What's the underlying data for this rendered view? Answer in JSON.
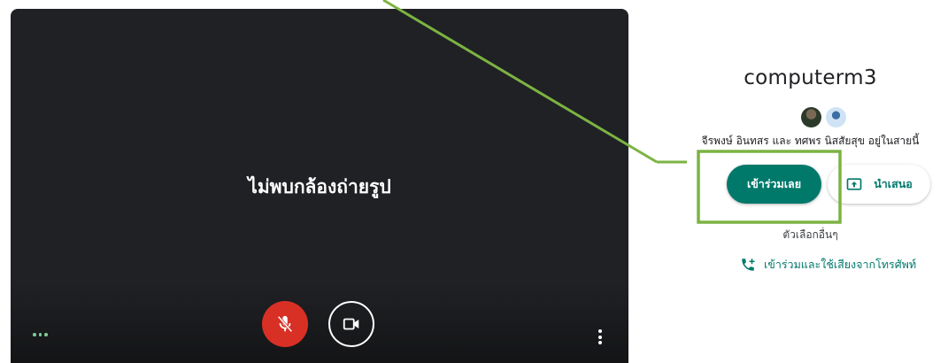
{
  "preview": {
    "no_camera_text": "ไม่พบกล้องถ่ายรูป",
    "mic_icon": "mic-off-icon",
    "camera_icon": "videocam-icon",
    "more_icon": "more-vert-icon",
    "effects_icon": "more-horiz-icon"
  },
  "meeting": {
    "title": "computerm3",
    "participants_text": "จีรพงษ์ อินทสร และ ทศพร นิสสัยสุข อยู่ในสายนี้"
  },
  "actions": {
    "join_label": "เข้าร่วมเลย",
    "present_label": "นำเสนอ",
    "other_options_label": "ตัวเลือกอื่นๆ",
    "phone_join_label": "เข้าร่วมและใช้เสียงจากโทรศัพท์"
  },
  "colors": {
    "accent": "#00796b",
    "mic_off": "#d93025",
    "annotation": "#7cb342",
    "preview_bg": "#202124"
  }
}
